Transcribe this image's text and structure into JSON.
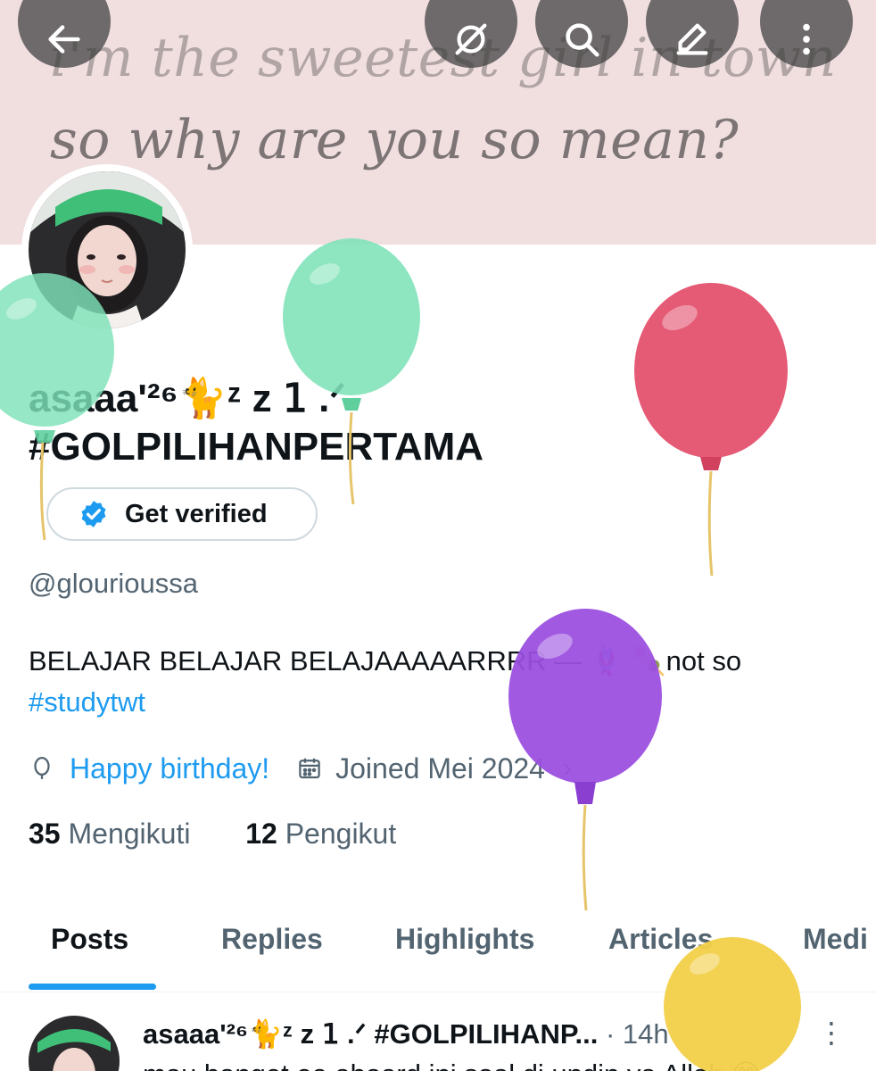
{
  "banner": {
    "line1": "i'm the sweetest girl in town",
    "line2": "so why are you so mean?"
  },
  "top_bar": {
    "icons": [
      "back-arrow-icon",
      "grok-icon",
      "search-icon",
      "edit-icon",
      "more-vertical-icon"
    ]
  },
  "profile": {
    "display_name_line1": "asaaa'²⁶🐈ᶻ z 𝟣 .ᐟ",
    "display_name_line2": "#GOLPILIHANPERTAMA",
    "verify_label": "Get verified",
    "handle": "@glourioussa",
    "bio_text": "BELAJAR BELAJAR BELAJAAAAARRRR — 🪢 🍡not so",
    "bio_tag": "#studytwt",
    "birthday": "Happy birthday!",
    "joined": "Joined Mei 2024",
    "following_count": "35",
    "following_label": "Mengikuti",
    "followers_count": "12",
    "followers_label": "Pengikut"
  },
  "tabs": [
    {
      "label": "Posts",
      "active": true
    },
    {
      "label": "Replies",
      "active": false
    },
    {
      "label": "Highlights",
      "active": false
    },
    {
      "label": "Articles",
      "active": false
    },
    {
      "label": "Medi",
      "active": false
    }
  ],
  "post": {
    "author": "asaaa'²⁶🐈ᶻ z 𝟣 .ᐟ #GOLPILIHANP...",
    "time": "· 14h",
    "text": "mau banget ee aboard ini soal di undin ya Allah 😊"
  },
  "colors": {
    "accent": "#1d9bf0",
    "banner_bg": "#f1dfe0",
    "balloon_green": "#7ee2b8",
    "balloon_red": "#e55a75",
    "balloon_purple": "#9b4fe0",
    "balloon_yellow": "#f3cf4a"
  }
}
